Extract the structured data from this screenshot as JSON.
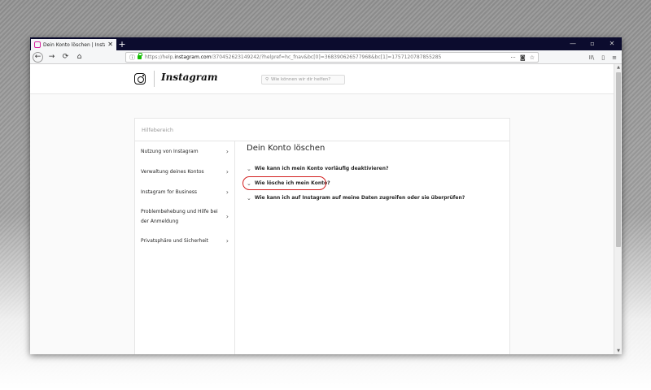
{
  "browser": {
    "tab_title": "Dein Konto löschen | Instagram…",
    "tab_close": "✕",
    "new_tab": "+",
    "window_controls": {
      "minimize": "—",
      "maximize": "▫",
      "close": "✕"
    },
    "nav": {
      "back": "←",
      "forward": "→",
      "reload": "⟳",
      "home": "⌂"
    },
    "url": {
      "prefix": "https://help.",
      "domain": "instagram.com",
      "rest": "/370452623149242/?helpref=hc_fnav&bc[0]=368390626577968&bc[1]=1757120787855285"
    },
    "url_icons": {
      "more": "···",
      "pocket": "◙",
      "bookmark": "☆"
    },
    "right_icons": {
      "library": "II\\",
      "sidebar": "▯",
      "menu": "≡"
    }
  },
  "instagram": {
    "wordmark": "Instagram",
    "search_placeholder": "Wie können wir dir helfen?"
  },
  "help": {
    "section_title": "Hilfebereich",
    "sidebar": [
      {
        "label": "Nutzung von Instagram"
      },
      {
        "label": "Verwaltung deines Kontos"
      },
      {
        "label": "Instagram for Business"
      },
      {
        "label": "Problembehebung und Hilfe bei der Anmeldung"
      },
      {
        "label": "Privatsphäre und Sicherheit"
      }
    ],
    "page_title": "Dein Konto löschen",
    "questions": [
      {
        "label": "Wie kann ich mein Konto vorläufig deaktivieren?"
      },
      {
        "label": "Wie lösche ich mein Konto?"
      },
      {
        "label": "Wie kann ich auf Instagram auf meine Daten zugreifen oder sie überprüfen?"
      }
    ],
    "highlighted_question": "Wie lösche ich mein Konto?"
  },
  "colors": {
    "titlebar": "#0c0c2e",
    "highlight_circle": "#d32020",
    "secure_lock": "#12bc00"
  }
}
